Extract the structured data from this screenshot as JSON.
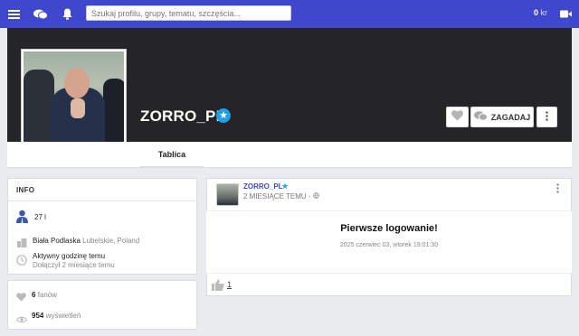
{
  "topbar": {
    "search_placeholder": "Szukaj profilu, grupy, tematu, szczęścia...",
    "wallet_amount": "0",
    "wallet_unit": "kr"
  },
  "profile": {
    "name": "ZORRO_PL",
    "ask_button": "ZAGADAJ"
  },
  "tabs": [
    {
      "label": "Tablica"
    }
  ],
  "info": {
    "title": "INFO",
    "age": "27 l",
    "city": "Biała Podlaska",
    "region": "Lubelskie, Poland",
    "activity": "Aktywny godzinę temu",
    "joined": "Dołączył 2 miesiące temu"
  },
  "stats": {
    "fans_count": "6",
    "fans_label": "fanów",
    "views_count": "954",
    "views_label": "wyświetleń"
  },
  "post": {
    "author": "ZORRO_PL",
    "time": "2 MIESIĄCE TEMU ·",
    "title": "Pierwsze logowanie!",
    "date": "2025 czerwiec 03, wtorek 19:01:30",
    "likes": "1"
  },
  "colors": {
    "accent": "#3f48cc",
    "cover": "#252527",
    "verified": "#1fa0e6"
  }
}
